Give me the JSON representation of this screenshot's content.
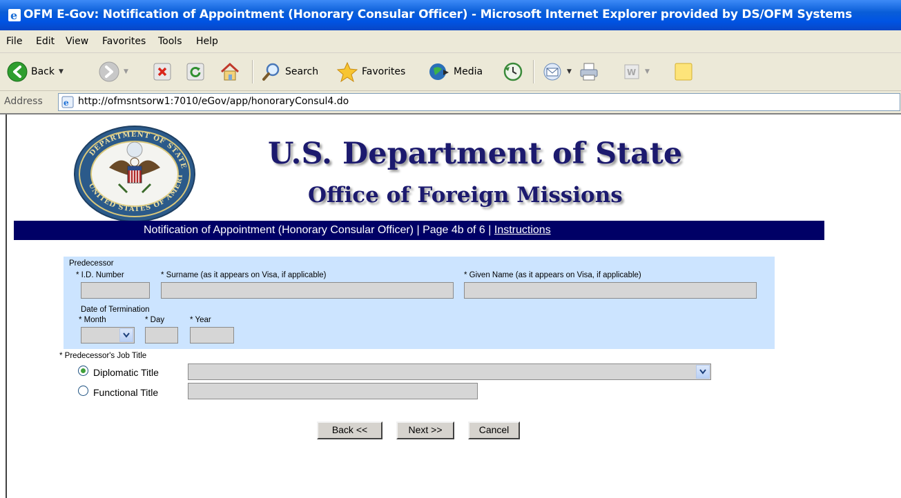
{
  "window": {
    "title": "OFM E-Gov: Notification of Appointment (Honorary Consular Officer) - Microsoft Internet Explorer provided by DS/OFM Systems"
  },
  "menu": {
    "items": [
      "File",
      "Edit",
      "View",
      "Favorites",
      "Tools",
      "Help"
    ]
  },
  "toolbar": {
    "back_label": "Back",
    "search_label": "Search",
    "favorites_label": "Favorites",
    "media_label": "Media"
  },
  "address": {
    "label": "Address",
    "url": "http://ofmsntsorw1:7010/eGov/app/honoraryConsul4.do"
  },
  "header": {
    "title": "U.S. Department of State",
    "subtitle": "Office of Foreign Missions",
    "seal_text": "DEPARTMENT OF STATE · UNITED STATES OF AMERICA"
  },
  "nav": {
    "form_title": "Notification of Appointment (Honorary Consular Officer)",
    "separator": "|",
    "page": "Page 4b of 6",
    "instructions": "Instructions"
  },
  "predecessor": {
    "section_label": "Predecessor",
    "id_label": "* I.D. Number",
    "surname_label": "* Surname (as it appears on Visa, if applicable)",
    "given_label": "* Given Name (as it appears on Visa, if applicable)",
    "id_value": "",
    "surname_value": "",
    "given_value": "",
    "termination_label": "Date of Termination",
    "month_label": "* Month",
    "day_label": "* Day",
    "year_label": "* Year",
    "month_value": "",
    "day_value": "",
    "year_value": ""
  },
  "job_title": {
    "label": "* Predecessor's Job Title",
    "diplomatic_label": "Diplomatic Title",
    "functional_label": "Functional Title",
    "selected": "diplomatic",
    "diplomatic_value": "",
    "functional_value": ""
  },
  "buttons": {
    "back": "Back <<",
    "next": "Next >>",
    "cancel": "Cancel"
  },
  "colors": {
    "titlebar": "#0054e3",
    "nav_band": "#000066",
    "heading": "#1c1a6e",
    "predecessor_panel": "#cce4ff"
  }
}
